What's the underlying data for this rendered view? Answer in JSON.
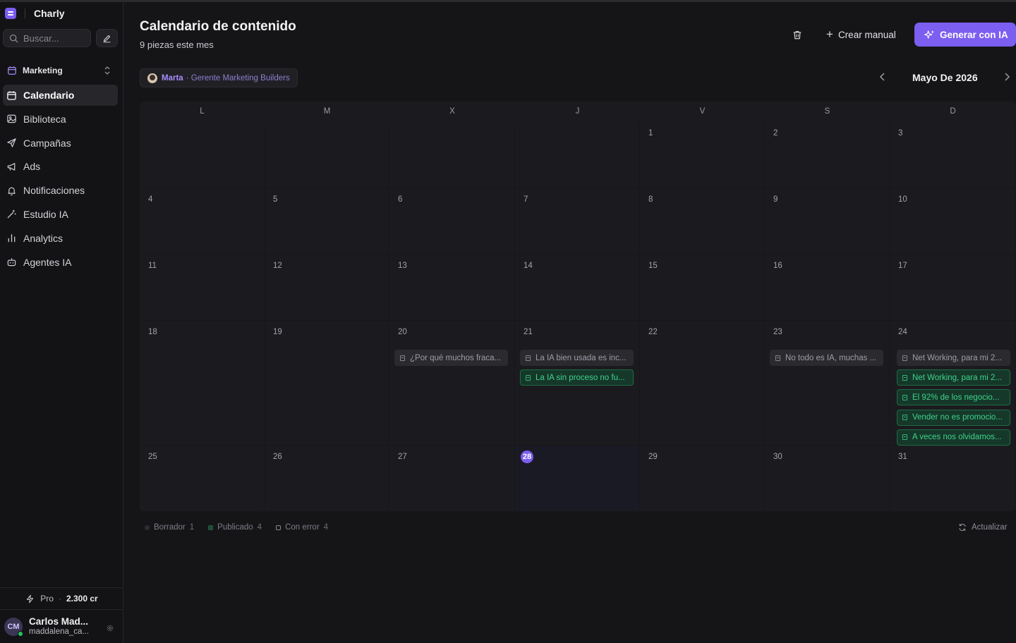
{
  "app": {
    "name": "Charly"
  },
  "sidebar": {
    "search_placeholder": "Buscar...",
    "workspace": "Marketing",
    "items": [
      {
        "label": "Calendario",
        "icon": "calendar-icon",
        "active": true
      },
      {
        "label": "Biblioteca",
        "icon": "image-icon",
        "active": false
      },
      {
        "label": "Campañas",
        "icon": "send-icon",
        "active": false
      },
      {
        "label": "Ads",
        "icon": "megaphone-icon",
        "active": false
      },
      {
        "label": "Notificaciones",
        "icon": "bell-icon",
        "active": false
      },
      {
        "label": "Estudio IA",
        "icon": "magic-wand-icon",
        "active": false
      },
      {
        "label": "Analytics",
        "icon": "bar-chart-icon",
        "active": false
      },
      {
        "label": "Agentes IA",
        "icon": "bot-icon",
        "active": false
      }
    ],
    "plan": "Pro",
    "credits": "2.300 cr",
    "user": {
      "initials": "CM",
      "name": "Carlos Mad...",
      "handle": "maddalena_ca..."
    }
  },
  "header": {
    "title": "Calendario de contenido",
    "subtitle": "9 piezas este mes",
    "manual_label": "Crear manual",
    "generate_label": "Generar con IA",
    "accent": "#7c5ef0"
  },
  "owner": {
    "name": "Marta",
    "role": "· Gerente Marketing Builders"
  },
  "calendar": {
    "month_label": "Mayo De 2026",
    "weekdays": [
      "L",
      "M",
      "X",
      "J",
      "V",
      "S",
      "D"
    ],
    "today": "28",
    "weeks": [
      [
        {
          "day": "",
          "posts": []
        },
        {
          "day": "",
          "posts": []
        },
        {
          "day": "",
          "posts": []
        },
        {
          "day": "",
          "posts": []
        },
        {
          "day": "1",
          "posts": []
        },
        {
          "day": "2",
          "posts": []
        },
        {
          "day": "3",
          "posts": []
        }
      ],
      [
        {
          "day": "4",
          "posts": []
        },
        {
          "day": "5",
          "posts": []
        },
        {
          "day": "6",
          "posts": []
        },
        {
          "day": "7",
          "posts": []
        },
        {
          "day": "8",
          "posts": []
        },
        {
          "day": "9",
          "posts": []
        },
        {
          "day": "10",
          "posts": []
        }
      ],
      [
        {
          "day": "11",
          "posts": []
        },
        {
          "day": "12",
          "posts": []
        },
        {
          "day": "13",
          "posts": []
        },
        {
          "day": "14",
          "posts": []
        },
        {
          "day": "15",
          "posts": []
        },
        {
          "day": "16",
          "posts": []
        },
        {
          "day": "17",
          "posts": []
        }
      ],
      [
        {
          "day": "18",
          "posts": []
        },
        {
          "day": "19",
          "posts": []
        },
        {
          "day": "20",
          "posts": [
            {
              "text": "¿Por qué muchos fraca...",
              "status": "draft"
            }
          ]
        },
        {
          "day": "21",
          "posts": [
            {
              "text": "La IA bien usada es inc...",
              "status": "draft"
            },
            {
              "text": "La IA sin proceso no fu...",
              "status": "published"
            }
          ]
        },
        {
          "day": "22",
          "posts": []
        },
        {
          "day": "23",
          "posts": [
            {
              "text": "No todo es IA, muchas ...",
              "status": "draft"
            }
          ]
        },
        {
          "day": "24",
          "posts": [
            {
              "text": "Net Working, para mi 2...",
              "status": "draft"
            },
            {
              "text": "Net Working, para mi 2...",
              "status": "published"
            },
            {
              "text": "El 92% de los negocio...",
              "status": "published"
            },
            {
              "text": "Vender no es promocio...",
              "status": "published"
            },
            {
              "text": "A veces nos olvidamos...",
              "status": "published"
            }
          ]
        }
      ],
      [
        {
          "day": "25",
          "posts": []
        },
        {
          "day": "26",
          "posts": []
        },
        {
          "day": "27",
          "posts": []
        },
        {
          "day": "28",
          "posts": []
        },
        {
          "day": "29",
          "posts": []
        },
        {
          "day": "30",
          "posts": []
        },
        {
          "day": "31",
          "posts": []
        }
      ]
    ]
  },
  "legend": {
    "draft_label": "Borrador",
    "draft_count": "1",
    "published_label": "Publicado",
    "published_count": "4",
    "error_label": "Con error",
    "error_count": "4"
  },
  "refresh_label": "Actualizar"
}
